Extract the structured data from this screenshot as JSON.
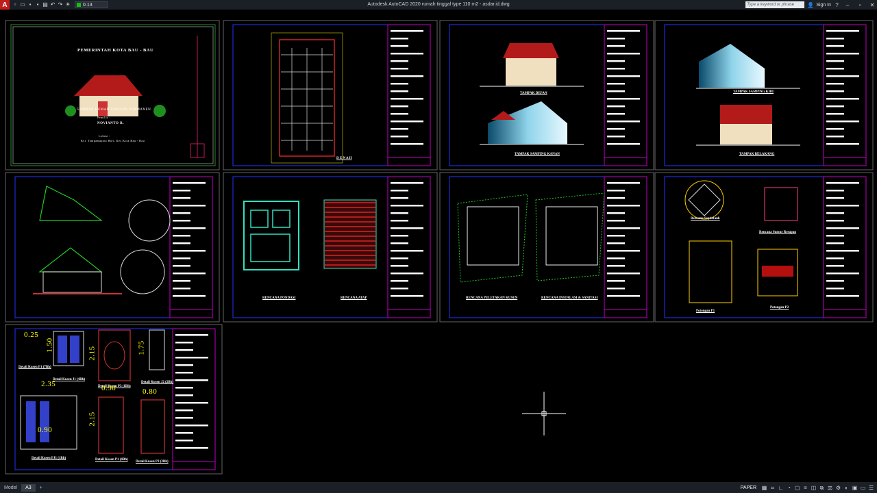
{
  "app": {
    "title": "Autodesk AutoCAD 2020   rumah tinggal type 110 m2 - asdar.id.dwg",
    "logo": "A",
    "layer_value": "0.13"
  },
  "search": {
    "placeholder": "Type a keyword or phrase"
  },
  "account": {
    "sign_in": "Sign In"
  },
  "layout_tabs": [
    "Model",
    "A3"
  ],
  "status": {
    "paper": "PAPER"
  },
  "cover": {
    "heading": "PEMERINTAH KOTA BAU - BAU",
    "subtitle": "GAMBAR RUMAH TINGGAL PERMANEN",
    "owner_label": "Pemilik :",
    "owner": "NOVIANTO R.",
    "location_label": "Lokasi :",
    "location": "Kel. Tampamapata Hari, Kec.Kota Bau - Bau"
  },
  "sheets": {
    "denah": "D E N A H",
    "tampak_depan": "TAMPAK DEPAN",
    "tampak_samping_kanan": "TAMPAK SAMPING KANAN",
    "tampak_samping_kiri": "TAMPAK SAMPING KIRI",
    "tampak_belakang": "TAMPAK BELAKANG",
    "rencana_pondasi": "RENCANA PONDASI",
    "rencana_atap": "RENCANA ATAP",
    "rencana_peletakan": "RENCANA PELETAKAN KUSEN",
    "rencana_instalasi": "RENCANA INSTALASI & SANITASI",
    "rencana_septictank": "Rencana Septictank",
    "rencana_sumur": "Rencana Sumur Resapan",
    "potongan_p1": "Potongan P1",
    "potongan_p2": "Potongan P2",
    "detail_kusen_f1": "Detail Kusen F1 (7Bh)",
    "detail_kusen_j1": "Detail Kusen J1 (4Bh)",
    "detail_kusen_p3": "Detail Kusen P3 (1Bh)",
    "detail_kusen_j2": "Detail Kusen J2 (2Bh)",
    "detail_kusen_pj1": "Detail Kusen PJ1 (1Bh)",
    "detail_kusen_p1": "Detail Kusen P1 (4Bh)",
    "detail_kusen_p2": "Detail Kusen P2 (2Bh)"
  },
  "dimensions": {
    "d1": "0.25",
    "d2": "1.50",
    "d3": "2.15",
    "d4": "1.75",
    "d5": "2.35",
    "d6": "2.15",
    "d7": "0.90",
    "d8": "0.80",
    "d9": "0.90"
  },
  "sheet_numbers": [
    "01",
    "02",
    "03",
    "04",
    "05",
    "06",
    "07",
    "08"
  ]
}
